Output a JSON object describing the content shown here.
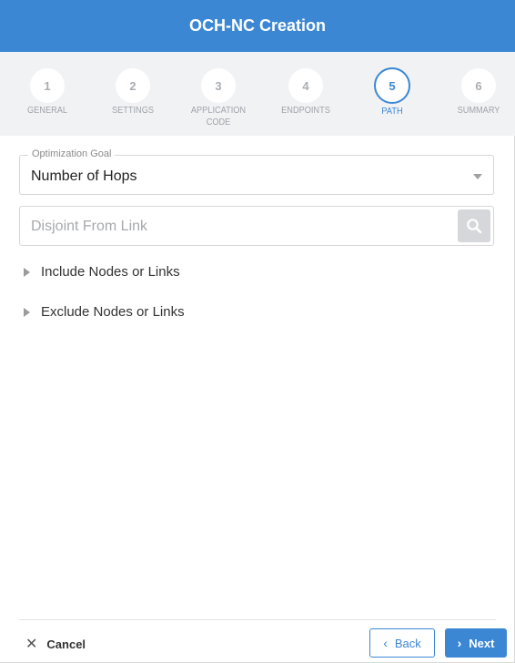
{
  "dialog": {
    "title": "OCH-NC Creation"
  },
  "steps": [
    {
      "number": "1",
      "label": "GENERAL"
    },
    {
      "number": "2",
      "label": "SETTINGS"
    },
    {
      "number": "3",
      "label_line1": "APPLICATION",
      "label_line2": "CODE"
    },
    {
      "number": "4",
      "label": "ENDPOINTS"
    },
    {
      "number": "5",
      "label": "PATH",
      "active": true
    },
    {
      "number": "6",
      "label": "SUMMARY"
    }
  ],
  "form": {
    "optimization_goal": {
      "label": "Optimization Goal",
      "value": "Number of Hops"
    },
    "disjoint_from_link": {
      "placeholder": "Disjoint From Link"
    },
    "include_section": "Include Nodes or Links",
    "exclude_section": "Exclude Nodes or Links"
  },
  "footer": {
    "cancel_label": "Cancel",
    "back_label": "Back",
    "next_label": "Next"
  },
  "colors": {
    "accent": "#3b87d4",
    "stepper_bg": "#f1f2f4"
  },
  "icons": {
    "cancel": "close-icon",
    "back": "chevron-left-icon",
    "next": "chevron-right-icon",
    "search": "search-icon",
    "dropdown": "caret-down-icon",
    "expand": "triangle-right-icon"
  }
}
